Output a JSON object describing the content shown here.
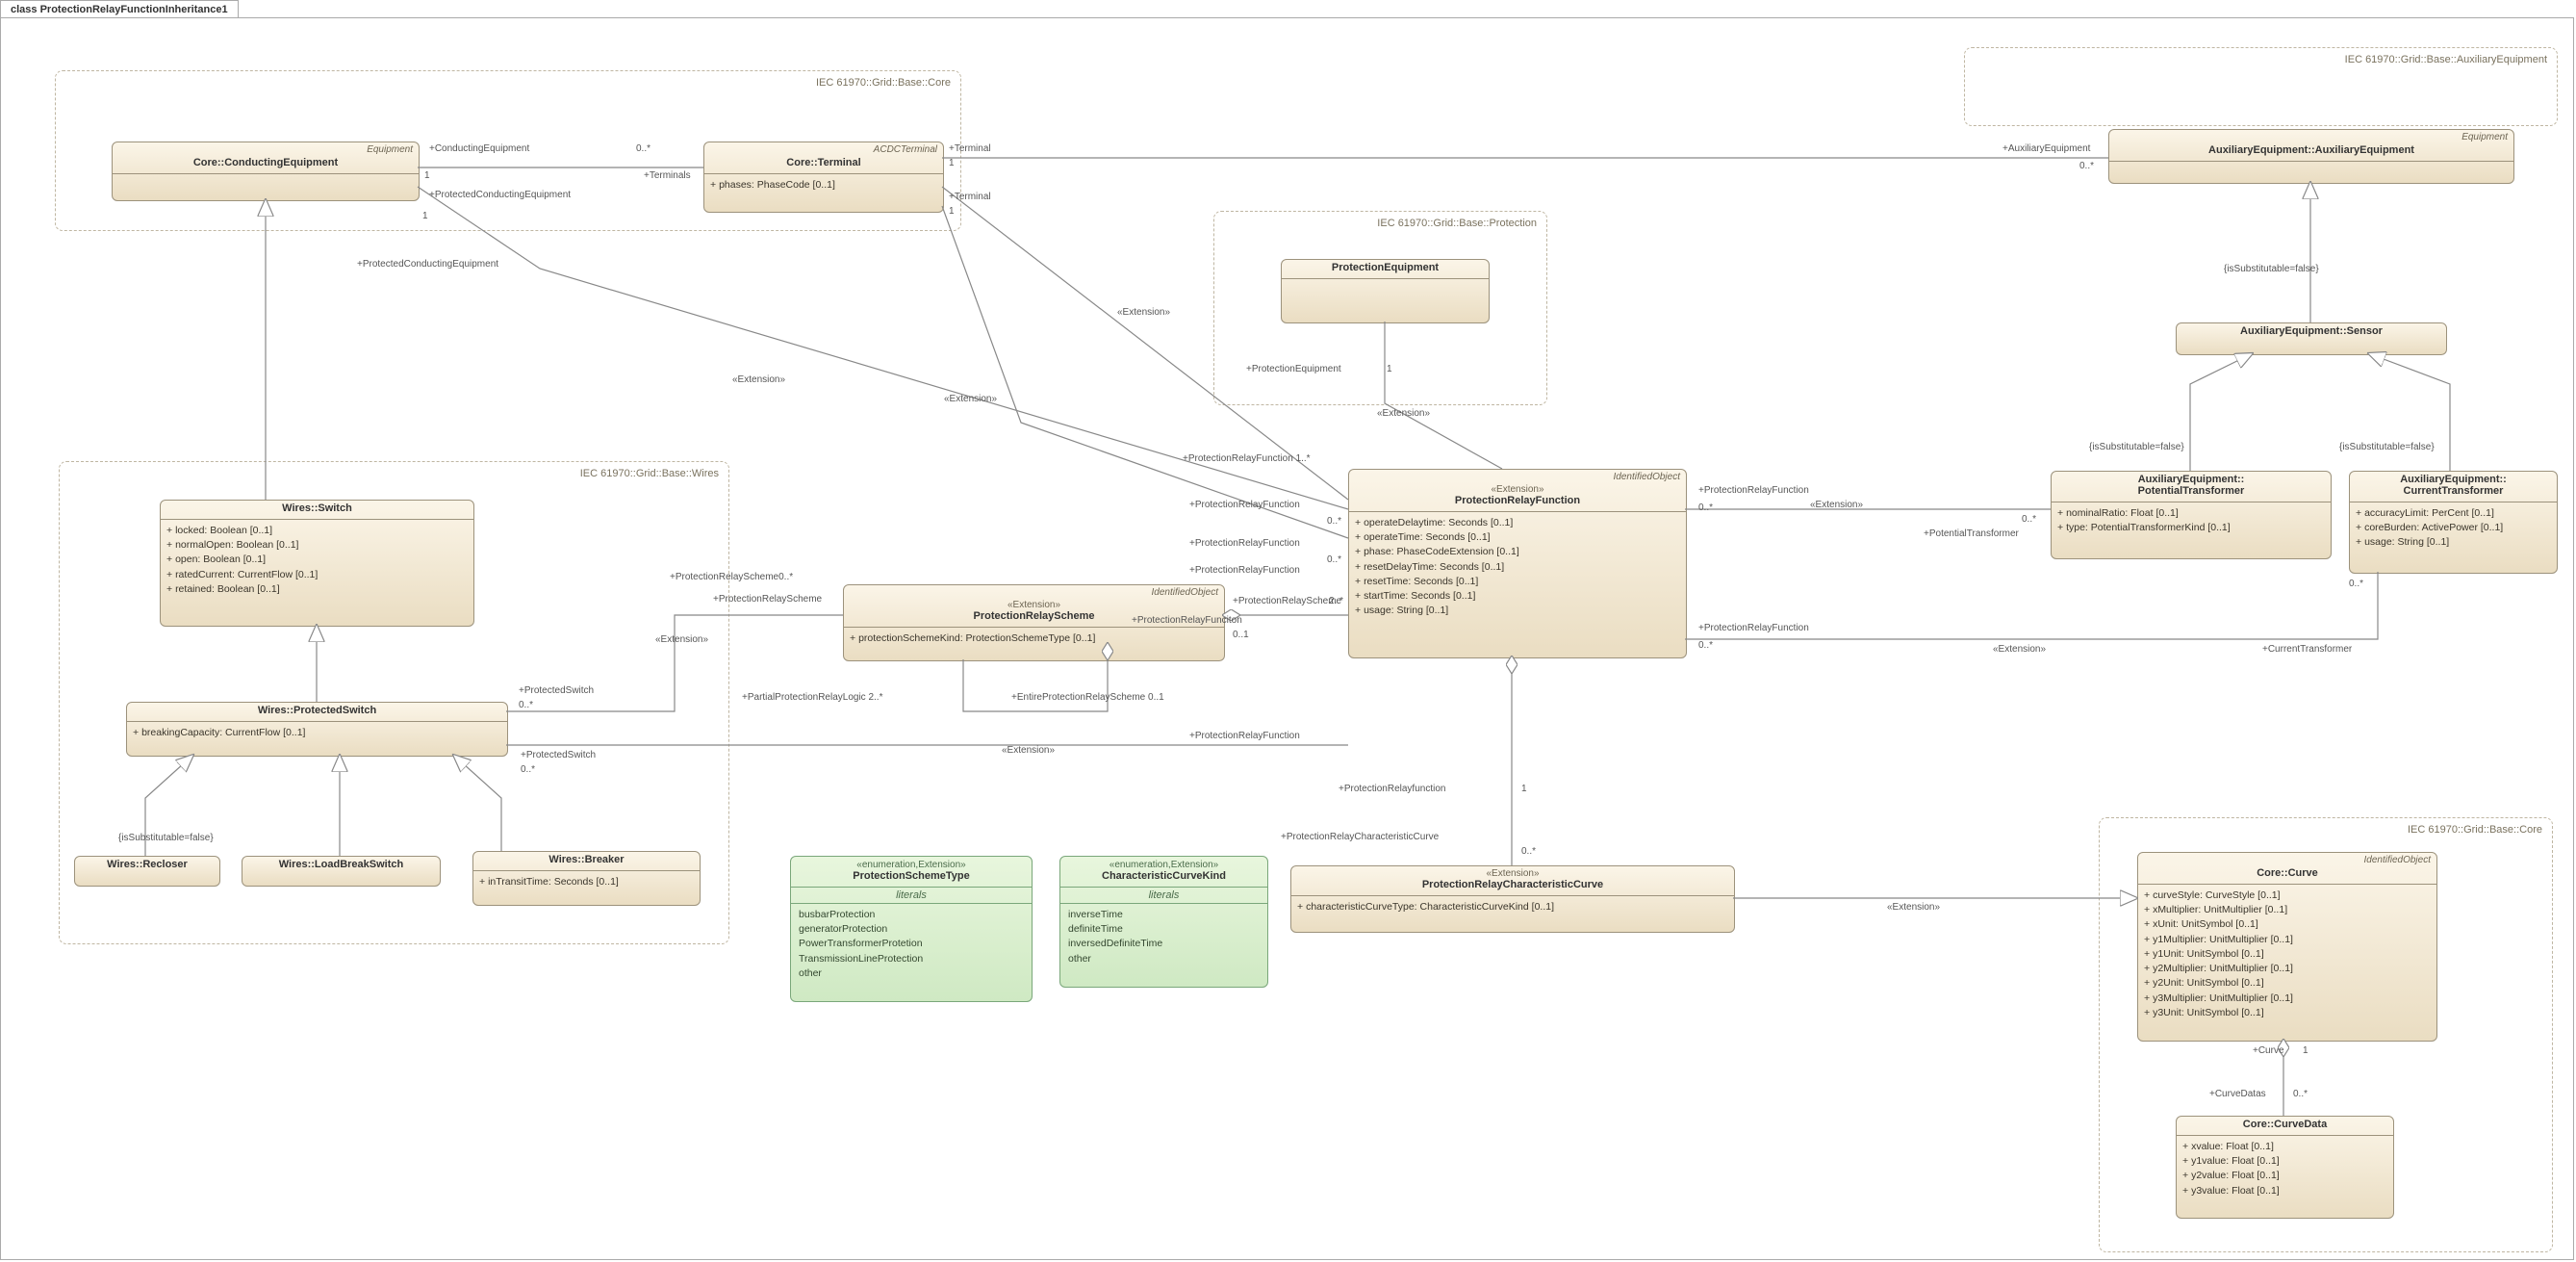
{
  "title": "class ProtectionRelayFunctionInheritance1",
  "packages": {
    "core": {
      "label": "IEC 61970::Grid::Base::Core"
    },
    "wires": {
      "label": "IEC 61970::Grid::Base::Wires"
    },
    "prot": {
      "label": "IEC 61970::Grid::Base::Protection"
    },
    "aux": {
      "label": "IEC 61970::Grid::Base::AuxiliaryEquipment"
    },
    "core2": {
      "label": "IEC 61970::Grid::Base::Core"
    }
  },
  "classes": {
    "condEq": {
      "stereo": "Equipment",
      "name": "Core::ConductingEquipment",
      "attrs": []
    },
    "terminal": {
      "stereo": "ACDCTerminal",
      "name": "Core::Terminal",
      "attrs": [
        "phases: PhaseCode [0..1]"
      ]
    },
    "switch": {
      "name": "Wires::Switch",
      "attrs": [
        "locked: Boolean [0..1]",
        "normalOpen: Boolean [0..1]",
        "open: Boolean [0..1]",
        "ratedCurrent: CurrentFlow [0..1]",
        "retained: Boolean [0..1]"
      ]
    },
    "protSwitch": {
      "name": "Wires::ProtectedSwitch",
      "attrs": [
        "breakingCapacity: CurrentFlow [0..1]"
      ]
    },
    "recloser": {
      "name": "Wires::Recloser",
      "attrs": []
    },
    "lbs": {
      "name": "Wires::LoadBreakSwitch",
      "attrs": []
    },
    "breaker": {
      "name": "Wires::Breaker",
      "attrs": [
        "inTransitTime: Seconds [0..1]"
      ]
    },
    "protEq": {
      "name": "ProtectionEquipment",
      "attrs": []
    },
    "prs": {
      "stereo": "IdentifiedObject",
      "ext": "«Extension»",
      "name": "ProtectionRelayScheme",
      "attrs": [
        "protectionSchemeKind: ProtectionSchemeType [0..1]"
      ]
    },
    "prf": {
      "stereo": "IdentifiedObject",
      "ext": "«Extension»",
      "name": "ProtectionRelayFunction",
      "attrs": [
        "operateDelaytime: Seconds [0..1]",
        "operateTime: Seconds [0..1]",
        "phase: PhaseCodeExtension [0..1]",
        "resetDelayTime: Seconds [0..1]",
        "resetTime: Seconds [0..1]",
        "startTime: Seconds [0..1]",
        "usage: String [0..1]"
      ]
    },
    "prcc": {
      "ext": "«Extension»",
      "name": "ProtectionRelayCharacteristicCurve",
      "attrs": [
        "characteristicCurveType: CharacteristicCurveKind [0..1]"
      ]
    },
    "auxEq": {
      "stereo": "Equipment",
      "name": "AuxiliaryEquipment::AuxiliaryEquipment",
      "attrs": []
    },
    "sensor": {
      "name": "AuxiliaryEquipment::Sensor",
      "attrs": []
    },
    "pt": {
      "name": "AuxiliaryEquipment::\nPotentialTransformer",
      "attrs": [
        "nominalRatio: Float [0..1]",
        "type: PotentialTransformerKind [0..1]"
      ]
    },
    "ct": {
      "name": "AuxiliaryEquipment::\nCurrentTransformer",
      "attrs": [
        "accuracyLimit: PerCent [0..1]",
        "coreBurden: ActivePower [0..1]",
        "usage: String [0..1]"
      ]
    },
    "curve": {
      "stereo": "IdentifiedObject",
      "name": "Core::Curve",
      "attrs": [
        "curveStyle: CurveStyle [0..1]",
        "xMultiplier: UnitMultiplier [0..1]",
        "xUnit: UnitSymbol [0..1]",
        "y1Multiplier: UnitMultiplier [0..1]",
        "y1Unit: UnitSymbol [0..1]",
        "y2Multiplier: UnitMultiplier [0..1]",
        "y2Unit: UnitSymbol [0..1]",
        "y3Multiplier: UnitMultiplier [0..1]",
        "y3Unit: UnitSymbol [0..1]"
      ]
    },
    "curveData": {
      "name": "Core::CurveData",
      "attrs": [
        "xvalue: Float [0..1]",
        "y1value: Float [0..1]",
        "y2value: Float [0..1]",
        "y3value: Float [0..1]"
      ]
    }
  },
  "enums": {
    "pst": {
      "stereo": "«enumeration,Extension»",
      "name": "ProtectionSchemeType",
      "lits": [
        "busbarProtection",
        "generatorProtection",
        "PowerTransformerProtetion",
        "TransmissionLineProtection",
        "other"
      ]
    },
    "cck": {
      "stereo": "«enumeration,Extension»",
      "name": "CharacteristicCurveKind",
      "lits": [
        "inverseTime",
        "definiteTime",
        "inversedDefiniteTime",
        "other"
      ]
    }
  },
  "labels": {
    "extension": "«Extension»",
    "isSubFalse": "{isSubstitutable=false}",
    "literals": "literals",
    "condEq_role": "+ConductingEquipment",
    "terminals_role": "+Terminals",
    "terminal_role": "+Terminal",
    "protCondEq": "+ProtectedConductingEquipment",
    "protSwitch_role": "+ProtectedSwitch",
    "prs_role": "+ProtectionRelayScheme",
    "prs_role0": "+ProtectionRelayScheme0..*",
    "partial": "+PartialProtectionRelayLogic 2..*",
    "entire": "+EntireProtectionRelayScheme 0..1",
    "prf_role": "+ProtectionRelayFunction",
    "prf_role1": "+ProtectionRelayFunction 1..*",
    "prf_funciton": "+ProtectionRelayFunciton",
    "prf_lower": "+ProtectionRelayfunction",
    "prcc_role": "+ProtectionRelayCharacteristicCurve",
    "protEq_role": "+ProtectionEquipment",
    "auxEq_role": "+AuxiliaryEquipment",
    "potXf": "+PotentialTransformer",
    "curXf": "+CurrentTransformer",
    "curve_role": "+Curve",
    "curveDatas": "+CurveDatas",
    "m1": "1",
    "m0s": "0..*",
    "m01": "0..1",
    "m2s": "2..*"
  }
}
